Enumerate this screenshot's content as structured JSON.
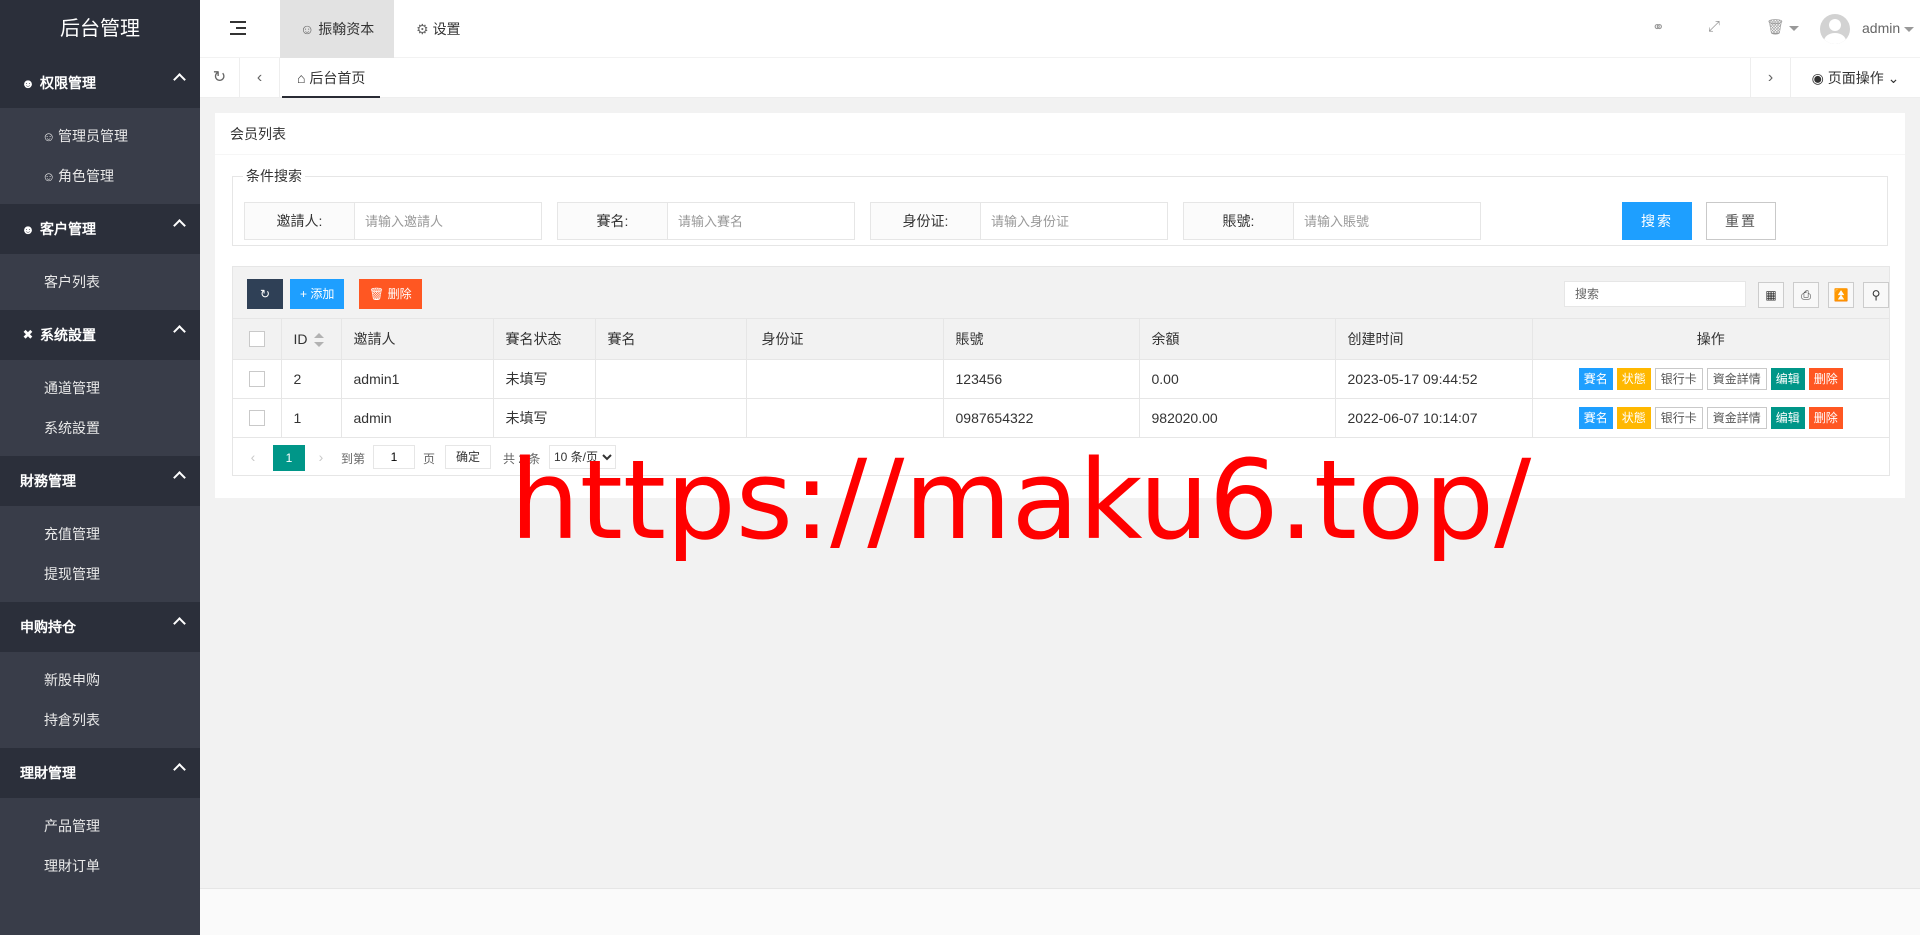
{
  "brand": "后台管理",
  "sidebar": {
    "groups": [
      {
        "label": "权限管理",
        "icon": "user-group-icon",
        "items": [
          {
            "label": "管理员管理",
            "icon": "user-icon"
          },
          {
            "label": "角色管理",
            "icon": "user-icon"
          }
        ]
      },
      {
        "label": "客户管理",
        "icon": "user-icon",
        "items": [
          {
            "label": "客户列表"
          }
        ]
      },
      {
        "label": "系统設置",
        "icon": "tools-icon",
        "items": [
          {
            "label": "通道管理"
          },
          {
            "label": "系统設置"
          }
        ]
      },
      {
        "label": "財務管理",
        "items": [
          {
            "label": "充值管理"
          },
          {
            "label": "提现管理"
          }
        ]
      },
      {
        "label": "申购持仓",
        "items": [
          {
            "label": "新股申购"
          },
          {
            "label": "持倉列表"
          }
        ]
      },
      {
        "label": "理財管理",
        "items": [
          {
            "label": "产品管理"
          },
          {
            "label": "理財订单"
          }
        ]
      }
    ]
  },
  "header": {
    "tabs": [
      {
        "label": "振翰资本",
        "icon": "user-icon"
      },
      {
        "label": "设置",
        "icon": "gear-icon"
      }
    ],
    "user": "admin"
  },
  "tabbar": {
    "home_tab": "后台首页",
    "page_ops": "页面操作"
  },
  "panel": {
    "title": "会员列表",
    "search": {
      "legend": "条件搜索",
      "fields": [
        {
          "label": "邀請人:",
          "placeholder": "请输入邀請人"
        },
        {
          "label": "賽名:",
          "placeholder": "请输入賽名"
        },
        {
          "label": "身份证:",
          "placeholder": "请输入身份证"
        },
        {
          "label": "賬號:",
          "placeholder": "请输入賬號"
        }
      ],
      "search_btn": "搜索",
      "reset_btn": "重置"
    },
    "toolbar": {
      "add": "添加",
      "delete": "删除",
      "search_placeholder": "搜索"
    },
    "table": {
      "columns": [
        "ID",
        "邀請人",
        "賽名状态",
        "賽名",
        "身份证",
        "賬號",
        "余額",
        "创建时间",
        "操作"
      ],
      "rows": [
        {
          "id": "2",
          "inviter": "admin1",
          "status": "未填写",
          "name": "",
          "idcard": "",
          "account": "123456",
          "balance": "0.00",
          "created": "2023-05-17 09:44:52"
        },
        {
          "id": "1",
          "inviter": "admin",
          "status": "未填写",
          "name": "",
          "idcard": "",
          "account": "0987654322",
          "balance": "982020.00",
          "created": "2022-06-07 10:14:07"
        }
      ],
      "actions": [
        "賽名",
        "状態",
        "银行卡",
        "資金詳情",
        "编辑",
        "删除"
      ]
    },
    "pager": {
      "current": "1",
      "goto_label": "到第",
      "goto_value": "1",
      "page_unit": "页",
      "confirm": "确定",
      "total": "共 2 条",
      "per_page": "10 条/页"
    }
  },
  "watermark": "https://maku6.top/",
  "colors": {
    "sidebar": "#393d49",
    "sidebar_head": "#2b2f3a",
    "primary": "#1e9fff",
    "accent_green": "#009688",
    "danger": "#ff5722",
    "warn": "#ffb800"
  }
}
